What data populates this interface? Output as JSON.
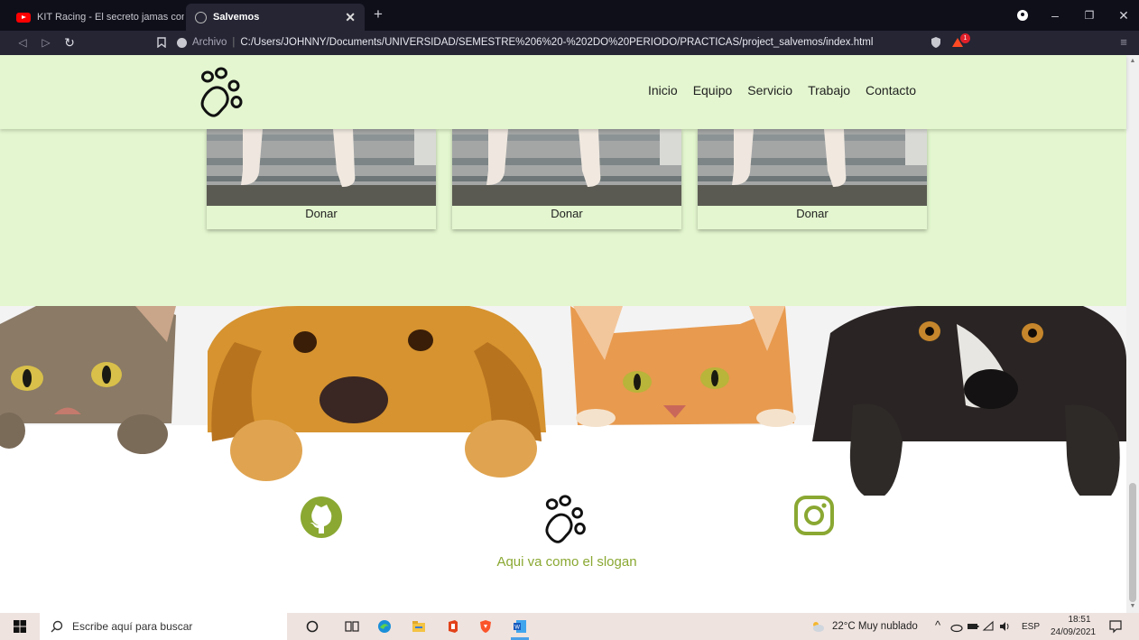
{
  "browser": {
    "tabs": [
      {
        "title": "KIT Racing - El secreto jamas contado."
      },
      {
        "title": "Salvemos"
      }
    ],
    "url_label": "Archivo",
    "url": "C:/Users/JOHNNY/Documents/UNIVERSIDAD/SEMESTRE%206%20-%202DO%20PERIODO/PRACTICAS/project_salvemos/index.html",
    "shield_badge": "1"
  },
  "site": {
    "nav": [
      "Inicio",
      "Equipo",
      "Servicio",
      "Trabajo",
      "Contacto"
    ],
    "cards": [
      {
        "label": "Donar"
      },
      {
        "label": "Donar"
      },
      {
        "label": "Donar"
      }
    ],
    "slogan": "Aqui va como el slogan"
  },
  "taskbar": {
    "search_placeholder": "Escribe aquí para buscar",
    "weather": "22°C  Muy nublado",
    "lang": "ESP",
    "time": "18:51",
    "date": "24/09/2021"
  },
  "colors": {
    "page_green": "#e3f6cf",
    "accent_olive": "#8aa832"
  }
}
